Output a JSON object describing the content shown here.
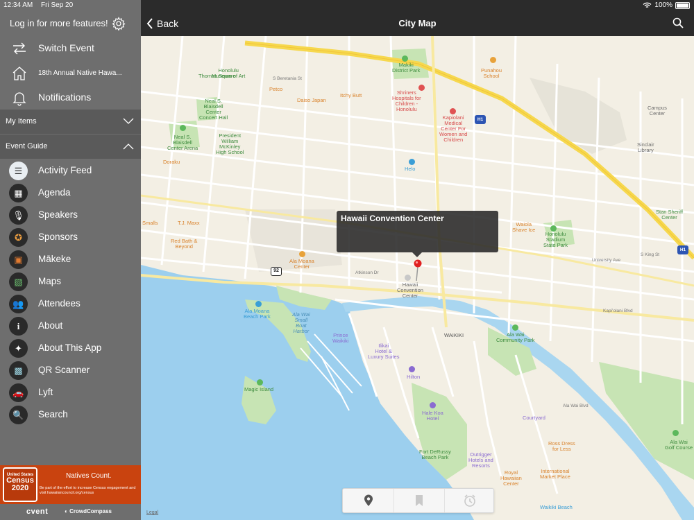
{
  "status": {
    "time": "12:34 AM",
    "date": "Fri Sep 20",
    "battery": "100%"
  },
  "sidebar": {
    "login_text": "Log in for more features!",
    "top_items": [
      {
        "label": "Switch Event",
        "icon": "swap-arrows-icon"
      },
      {
        "label": "18th Annual Native Hawa...",
        "icon": "home-icon"
      },
      {
        "label": "Notifications",
        "icon": "bell-icon"
      }
    ],
    "sections": {
      "my_items": "My Items",
      "event_guide": "Event Guide"
    },
    "guide_items": [
      {
        "label": "Activity Feed",
        "icon": "activity-feed-icon"
      },
      {
        "label": "Agenda",
        "icon": "calendar-icon"
      },
      {
        "label": "Speakers",
        "icon": "microphone-icon"
      },
      {
        "label": "Sponsors",
        "icon": "medal-icon"
      },
      {
        "label": "Mākeke",
        "icon": "bag-icon"
      },
      {
        "label": "Maps",
        "icon": "map-icon"
      },
      {
        "label": "Attendees",
        "icon": "people-icon"
      },
      {
        "label": "About",
        "icon": "info-icon"
      },
      {
        "label": "About This App",
        "icon": "app-icon"
      },
      {
        "label": "QR Scanner",
        "icon": "qr-icon"
      },
      {
        "label": "Lyft",
        "icon": "car-icon"
      },
      {
        "label": "Search",
        "icon": "magnifier-icon"
      }
    ],
    "banner": {
      "logo_line1": "United States",
      "logo_line2": "Census",
      "logo_line3": "2020",
      "title": "Natives Count.",
      "subtitle": "Be part of the effort to increase Census engagement and visit hawaiiancouncil.org/census"
    },
    "footer": {
      "cvent": "cvent",
      "crowdcompass": "CrowdCompass"
    }
  },
  "navbar": {
    "back_label": "Back",
    "title": "City Map"
  },
  "map": {
    "callout_title": "Hawaii Convention Center",
    "legal": "Legal",
    "labels": {
      "honolulu_museum": "Honolulu\nMuseum of Art",
      "thomas_square": "Thomas Square",
      "makiki": "Makiki\nDistrict Park",
      "punahou": "Punahou\nSchool",
      "beretania": "S Beretania St",
      "petco": "Petco",
      "daiso": "Daiso Japan",
      "itchy": "Itchy Butt",
      "shriners": "Shriners\nHospitals for\nChildren -\nHonolulu",
      "kapiolani_med": "Kapiolani\nMedical\nCenter For\nWomen and\nChildren",
      "neal": "Neal S.\nBlaisdell\nCenter\nConcert Hall",
      "neal_arena": "Neal S.\nBlaisdell\nCenter Arena",
      "mckinley": "President\nWilliam\nMcKinley\nHigh School",
      "doraku": "Doraku",
      "sinclair": "Sinclair\nLibrary",
      "campus": "Campus\nCenter",
      "stan": "Stan Sheriff\nCenter",
      "waiola": "Waiola\nShave Ice",
      "stadium": "Honolulu\nStadium\nState Park",
      "smalls": "Smalls",
      "tjmaxx": "T.J. Maxx",
      "redbath": "Red Bath &\nBeyond",
      "alamoana_center": "Ala Moana\nCenter",
      "convention": "Hawaii\nConvention\nCenter",
      "alamoana_park": "Ala Moana\nBeach Park",
      "alawai_harbor": "Ala Wai\nSmall\nBoat\nHarbor",
      "prince": "Prince\nWaikiki",
      "ilikai": "Ilikai\nHotel &\nLuxury Suites",
      "hilton": "Hilton",
      "waikiki": "WAIKIKI",
      "alawai_park": "Ala Wai\nCommunity Park",
      "magic": "Magic Island",
      "halekoa": "Hale Koa\nHotel",
      "courtyard": "Courtyard",
      "derussy": "Fort DeRussy\nBeach Park",
      "outrigger": "Outrigger\nHotels and\nResorts",
      "royal": "Royal\nHawaiian\nCenter",
      "rossdress": "Ross Dress\nfor Less",
      "intl": "International\nMarket Place",
      "alawai_golf": "Ala Wai\nGolf Course",
      "waikiki_beach": "Waikiki Beach",
      "kapiolani_blvd": "Kapiʻolani Blvd",
      "atkinson": "Atkinson Dr",
      "helo": "Helo",
      "s_king": "S King St",
      "university": "University Ave",
      "ala_wai_blvd": "Ala Wai Blvd",
      "route_92": "92",
      "h1_a": "H1",
      "h1_b": "H1"
    }
  },
  "toolbar": {
    "icons": [
      "location-pin-icon",
      "bookmark-icon",
      "clock-icon"
    ]
  },
  "colors": {
    "sidebar": "#6e6e6e",
    "navbar": "#2b2b2b",
    "water": "#9ccfee",
    "park": "#c7e4b4",
    "highway": "#f6d84e",
    "banner": "#c9430f"
  }
}
